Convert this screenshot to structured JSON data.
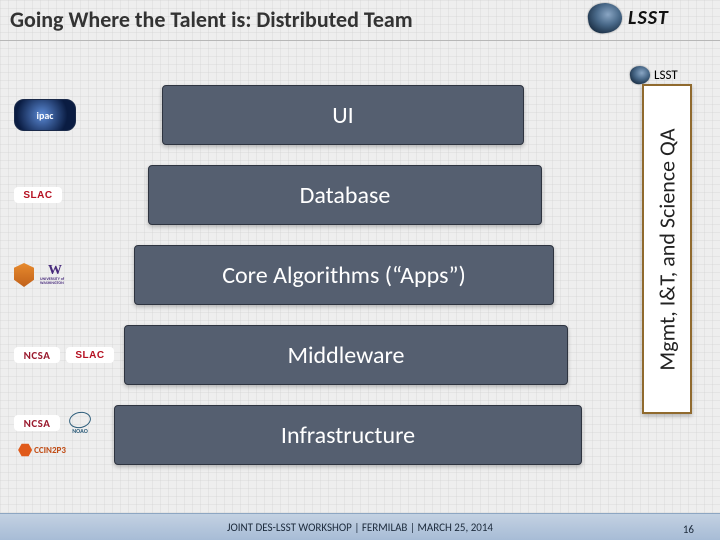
{
  "title": "Going Where the Talent is: Distributed Team",
  "brand": "LSST",
  "layers": {
    "l1": "UI",
    "l2": "Database",
    "l3": "Core Algorithms (“Apps”)",
    "l4": "Middleware",
    "l5": "Infrastructure"
  },
  "sidebar": "Mgmt, I&T, and Science QA",
  "orgs": {
    "ipac": "ipac",
    "slac": "SLAC",
    "uw_letter": "W",
    "uw_text": "UNIVERSITY of WASHINGTON",
    "ncsa": "NCSA",
    "noao": "NOAO",
    "ccin2p3": "CCIN2P3"
  },
  "footer": "JOINT DES-LSST WORKSHOP | FERMILAB | MARCH 25, 2014",
  "page": "16"
}
